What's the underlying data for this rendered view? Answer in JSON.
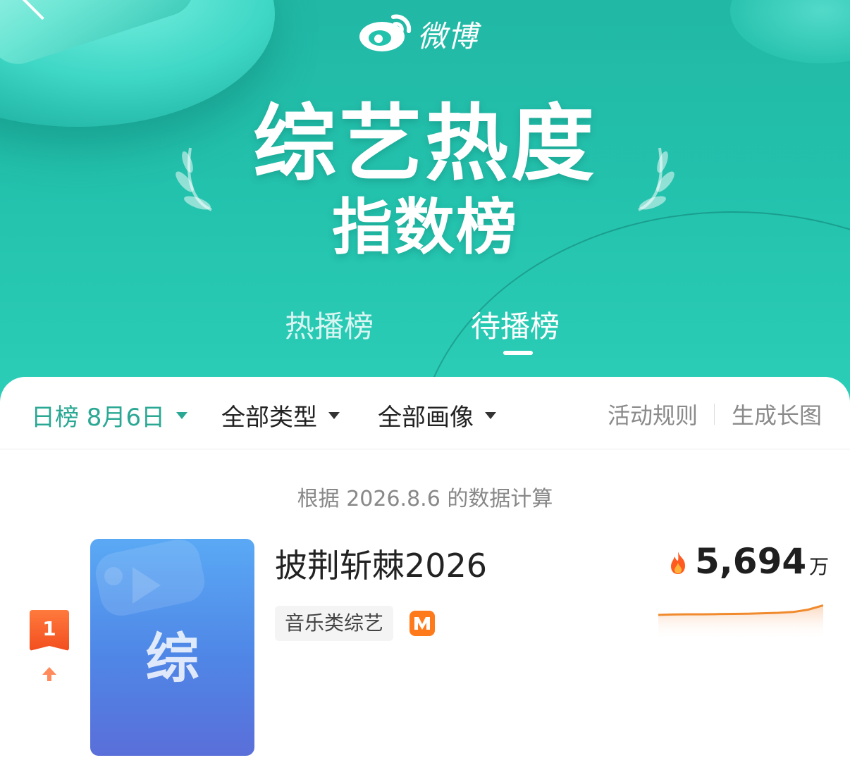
{
  "brand": {
    "name": "微博"
  },
  "header": {
    "title": "综艺热度",
    "subtitle": "指数榜",
    "tabs": [
      {
        "label": "热播榜",
        "active": false
      },
      {
        "label": "待播榜",
        "active": true
      }
    ]
  },
  "filters": {
    "date": "日榜 8月6日",
    "type": "全部类型",
    "persona": "全部画像",
    "rules_link": "活动规则",
    "long_image_link": "生成长图"
  },
  "data_note": "根据 2026.8.6 的数据计算",
  "list": [
    {
      "rank": "1",
      "trend": "up",
      "poster_char": "综",
      "title": "披荆斩棘2026",
      "genre": "音乐类综艺",
      "platform_icon": "mango-tv-icon",
      "heat_value": "5,694",
      "heat_unit": "万",
      "sparkline_trend": [
        0.8,
        0.78,
        0.77,
        0.77,
        0.76,
        0.75,
        0.74,
        0.72,
        0.7,
        0.66,
        0.55,
        0.35
      ]
    }
  ],
  "colors": {
    "header_teal": "#23c2ad",
    "active_filter": "#2aa894",
    "rank_badge": "#f24e1e",
    "sparkline": "#f08a2c"
  }
}
